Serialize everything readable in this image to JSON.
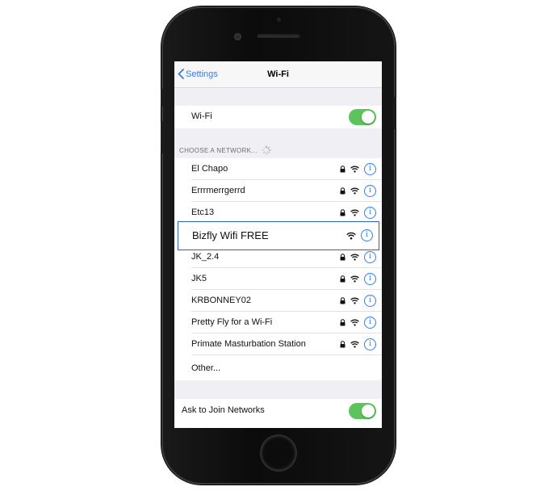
{
  "navbar": {
    "back_label": "Settings",
    "title": "Wi-Fi"
  },
  "wifi_toggle": {
    "label": "Wi-Fi",
    "on": true
  },
  "section_header": "CHOOSE A NETWORK...",
  "networks": [
    {
      "name": "El Chapo",
      "locked": true
    },
    {
      "name": "Errrmerrgerrd",
      "locked": true
    },
    {
      "name": "Etc13",
      "locked": true
    },
    {
      "name": "Bizfly Wifi FREE",
      "locked": false,
      "highlighted": true
    },
    {
      "name": "JK_2.4",
      "locked": true
    },
    {
      "name": "JK5",
      "locked": true
    },
    {
      "name": "KRBONNEY02",
      "locked": true
    },
    {
      "name": "Pretty Fly for a Wi-Fi",
      "locked": true
    },
    {
      "name": "Primate Masturbation Station",
      "locked": true
    }
  ],
  "other_label": "Other...",
  "ask_to_join": {
    "label": "Ask to Join Networks",
    "on": true
  },
  "colors": {
    "accent": "#2f7cf6",
    "toggle_on": "#5cc45a",
    "highlight_border": "#2f5fbf"
  }
}
